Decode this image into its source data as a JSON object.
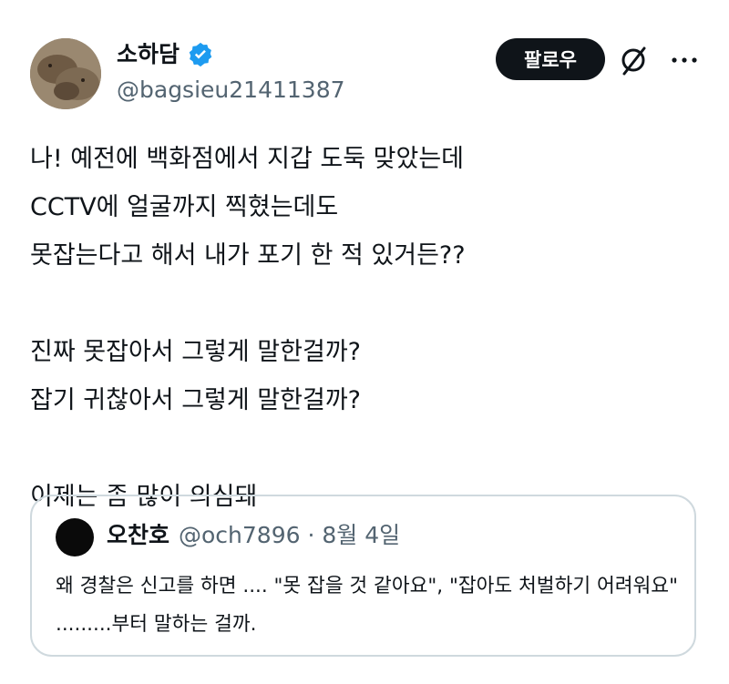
{
  "author": {
    "display_name": "소하담",
    "handle": "@bagsieu21411387",
    "verified": true,
    "avatar_icon": "capybara-avatar"
  },
  "actions": {
    "follow_label": "팔로우",
    "grok_icon": "grok-slash-icon",
    "more_icon": "more-dots-icon"
  },
  "tweet": {
    "text": "나! 예전에 백화점에서 지갑 도둑 맞았는데\nCCTV에 얼굴까지 찍혔는데도\n못잡는다고 해서 내가 포기 한 적 있거든??\n\n진짜 못잡아서 그렇게 말한걸까?\n잡기 귀찮아서 그렇게 말한걸까?\n\n이제는 좀 많이 의심돼"
  },
  "quote": {
    "display_name": "오찬호",
    "meta": "@och7896 · 8월 4일",
    "text": "왜 경찰은 신고를 하면 ....  \"못 잡을 것 같아요\", \"잡아도 처벌하기 어려워요\" .........부터 말하는 걸까."
  },
  "colors": {
    "text": "#0f1419",
    "secondary": "#536471",
    "verified_blue": "#1d9bf0",
    "border": "#cfd9de",
    "button_bg": "#0f1419"
  }
}
